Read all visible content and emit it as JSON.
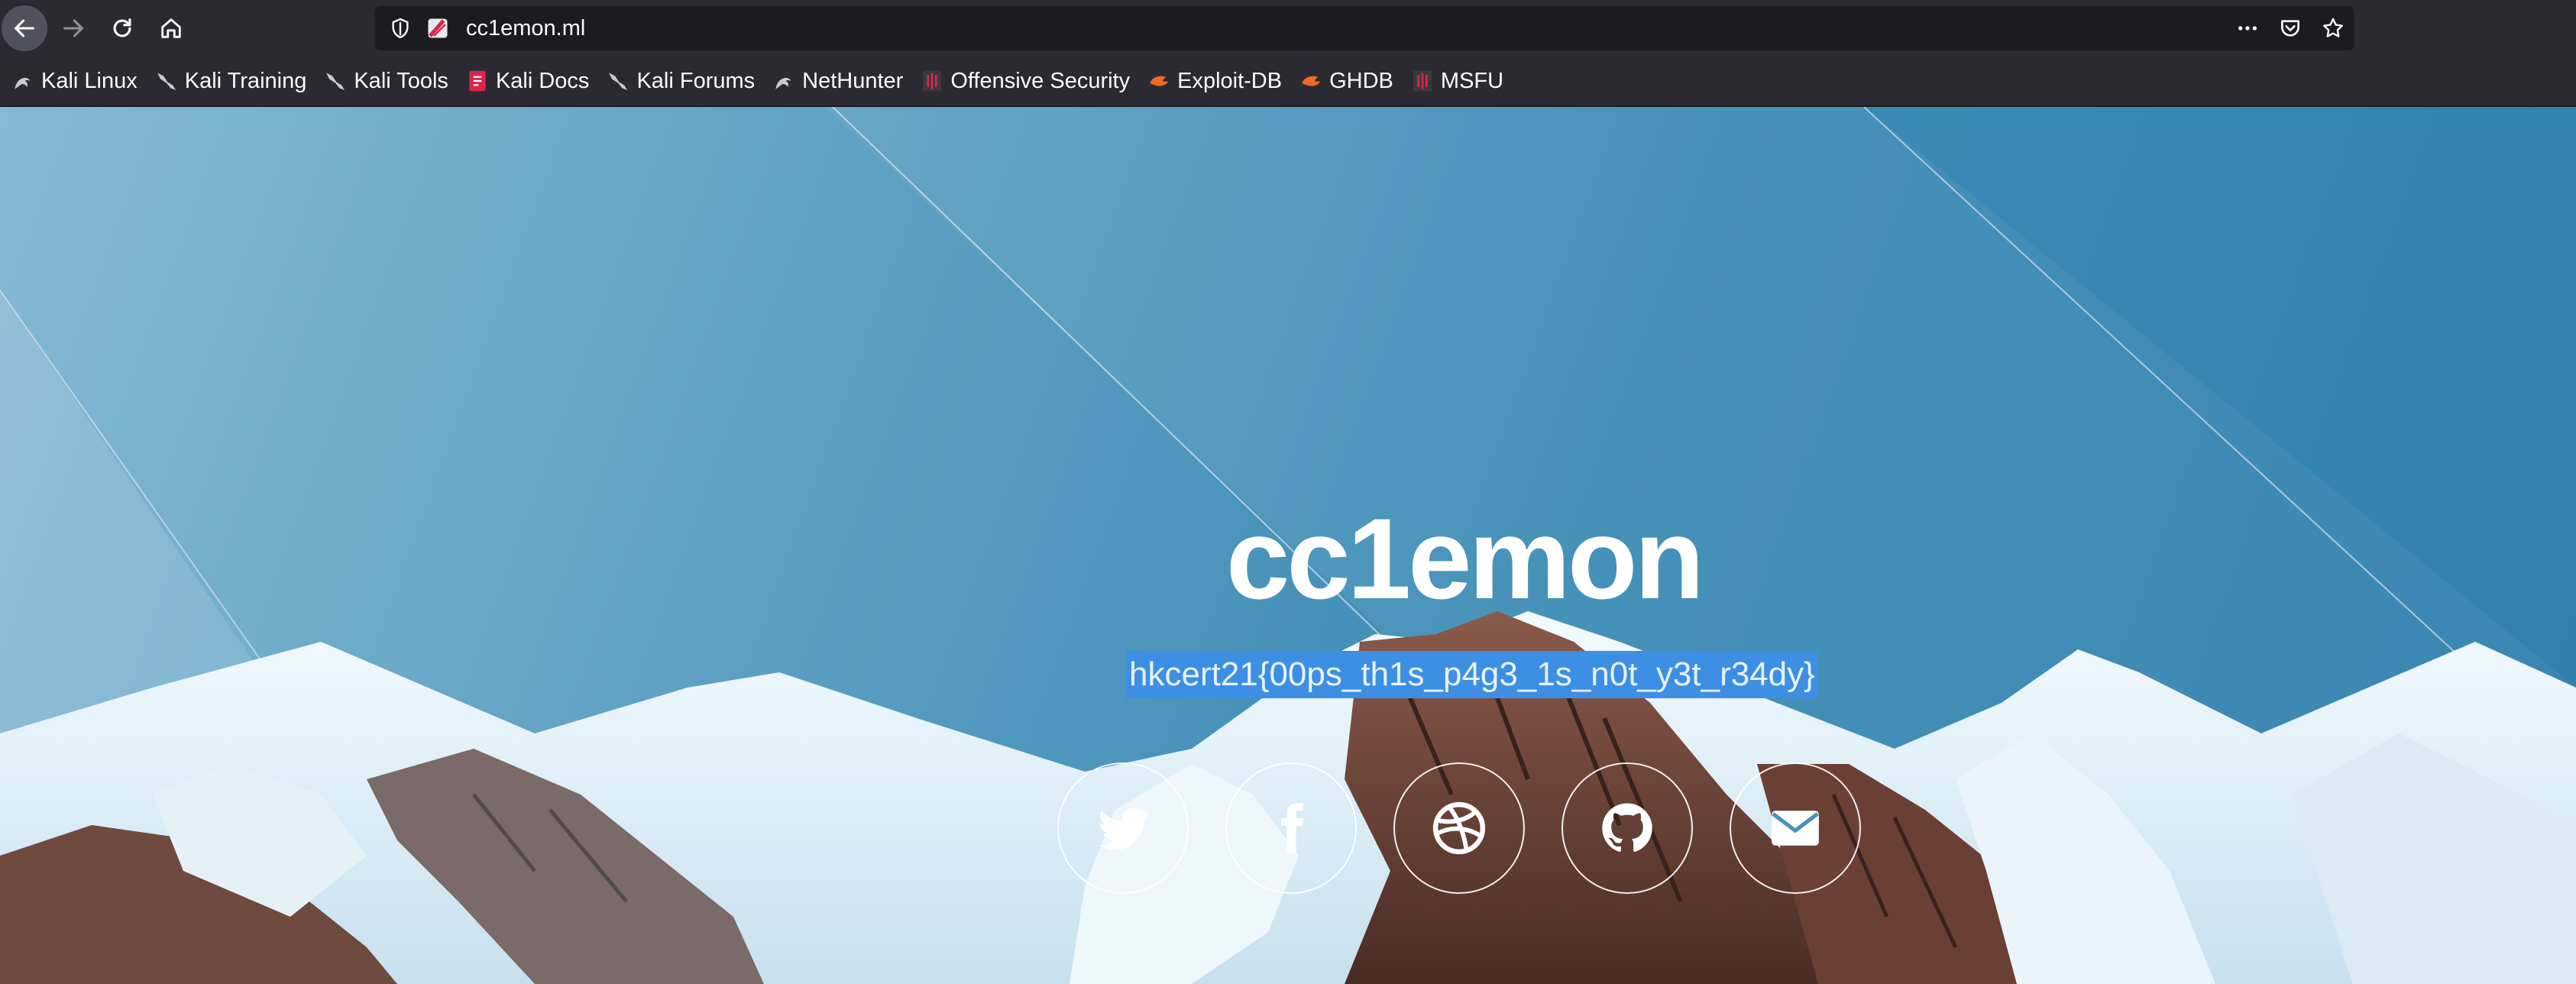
{
  "browser": {
    "url": "cc1emon.ml",
    "colors": {
      "toolbar": "#2b2a33",
      "urlbar": "#1c1b22",
      "text": "#fbfbfe"
    },
    "nav_icons": [
      "back-arrow-icon",
      "forward-arrow-icon",
      "reload-icon",
      "home-icon"
    ],
    "url_actions": [
      "more-actions-icon",
      "pocket-icon",
      "bookmark-star-icon"
    ]
  },
  "bookmarks": [
    {
      "label": "Kali Linux",
      "icon": "kali-dragon-icon"
    },
    {
      "label": "Kali Training",
      "icon": "kali-dragon-icon"
    },
    {
      "label": "Kali Tools",
      "icon": "kali-dragon-icon"
    },
    {
      "label": "Kali Docs",
      "icon": "kali-docs-icon"
    },
    {
      "label": "Kali Forums",
      "icon": "kali-dragon-icon"
    },
    {
      "label": "NetHunter",
      "icon": "kali-dragon-icon"
    },
    {
      "label": "Offensive Security",
      "icon": "offsec-icon"
    },
    {
      "label": "Exploit-DB",
      "icon": "exploit-db-icon"
    },
    {
      "label": "GHDB",
      "icon": "exploit-db-icon"
    },
    {
      "label": "MSFU",
      "icon": "offsec-icon"
    }
  ],
  "page": {
    "title": "cc1emon",
    "selected_text": "hkcert21{00ps_th1s_p4g3_1s_n0t_y3t_r34dy}",
    "selection_color": "#3d8fe3",
    "social_links": [
      {
        "name": "twitter-icon"
      },
      {
        "name": "facebook-icon"
      },
      {
        "name": "dribbble-icon"
      },
      {
        "name": "github-icon"
      },
      {
        "name": "envelope-icon"
      }
    ]
  }
}
